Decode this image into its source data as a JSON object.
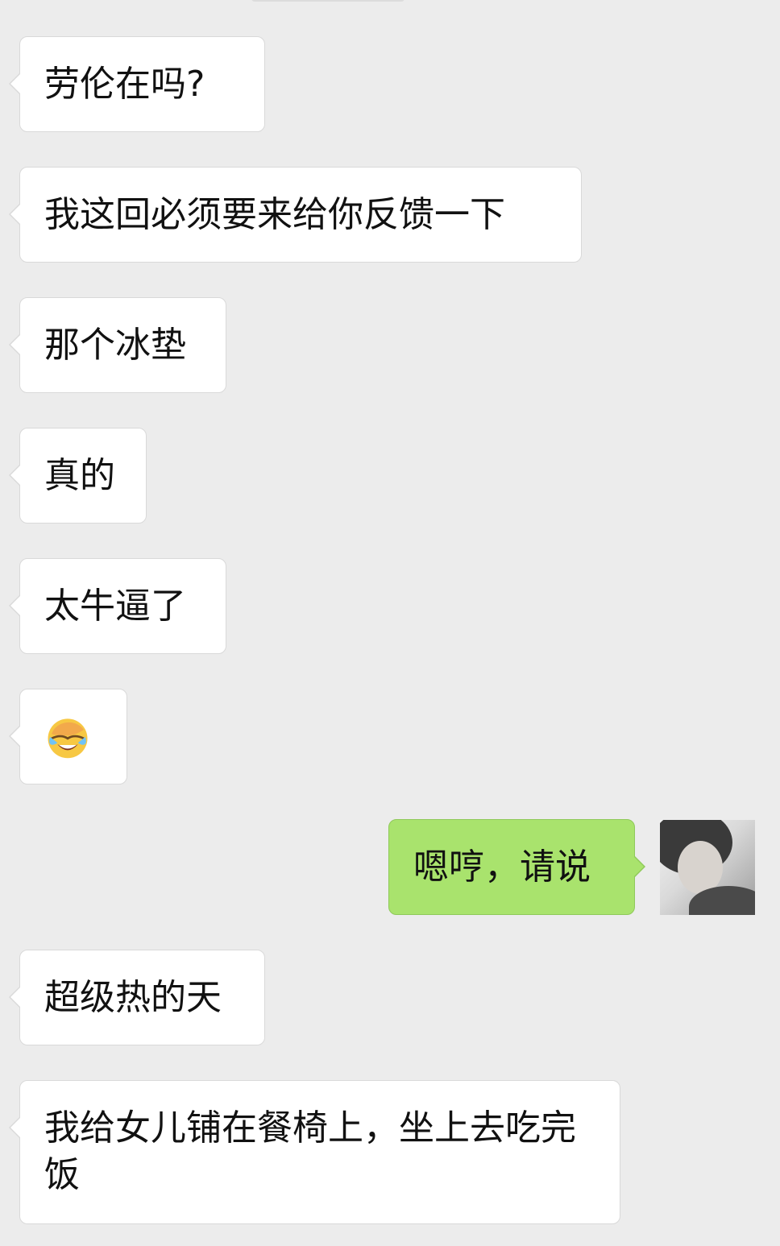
{
  "messages": [
    {
      "side": "left",
      "text": "劳伦在吗?"
    },
    {
      "side": "left",
      "text": "我这回必须要来给你反馈一下"
    },
    {
      "side": "left",
      "text": "那个冰垫"
    },
    {
      "side": "left",
      "text": "真的"
    },
    {
      "side": "left",
      "text": "太牛逼了"
    },
    {
      "side": "left",
      "emoji": "face-palm-laughing-emoji"
    },
    {
      "side": "right",
      "text": "嗯哼，请说"
    },
    {
      "side": "left",
      "text": "超级热的天"
    },
    {
      "side": "left",
      "text": "我给女儿铺在餐椅上，坐上去吃完饭"
    }
  ],
  "colors": {
    "background": "#ececec",
    "incoming_bubble": "#ffffff",
    "outgoing_bubble": "#a9e36d",
    "text": "#111111"
  }
}
